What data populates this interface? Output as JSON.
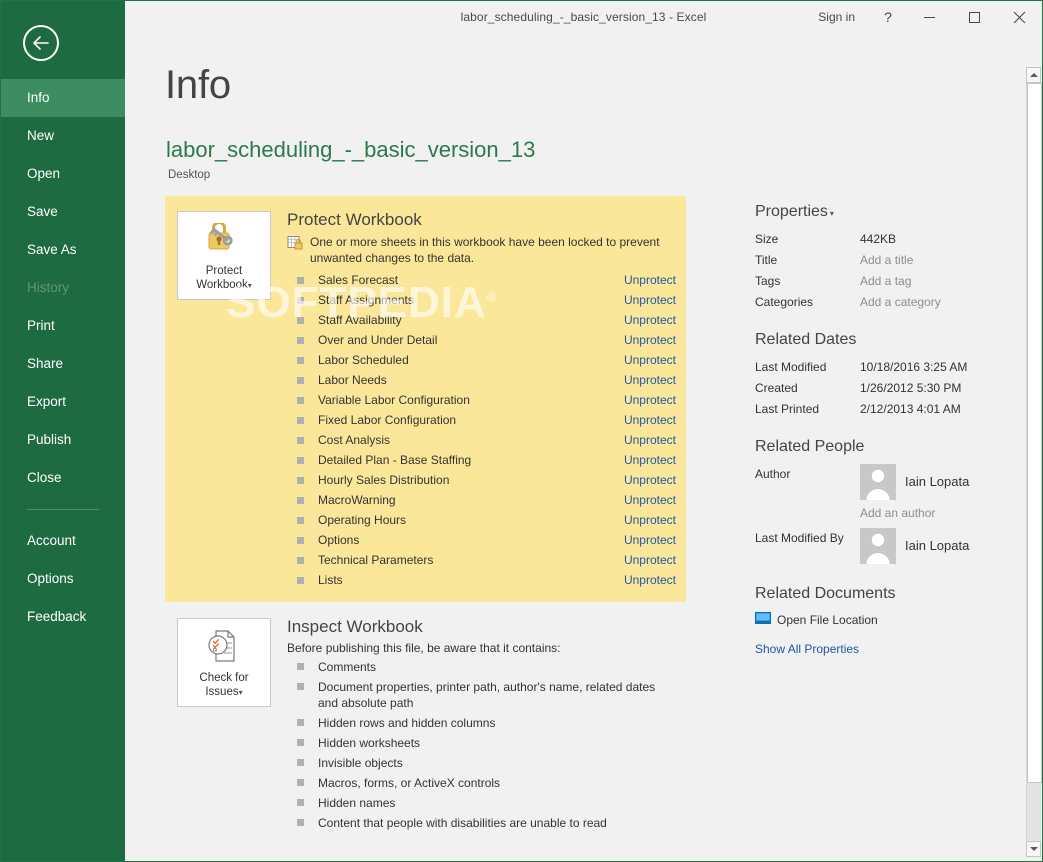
{
  "window": {
    "title": "labor_scheduling_-_basic_version_13 - Excel",
    "sign_in": "Sign in",
    "help_glyph": "?",
    "minimize_name": "minimize",
    "maximize_name": "maximize",
    "close_name": "close"
  },
  "sidebar": {
    "back_label": "Back",
    "items": [
      {
        "label": "Info",
        "state": "active"
      },
      {
        "label": "New",
        "state": "normal"
      },
      {
        "label": "Open",
        "state": "normal"
      },
      {
        "label": "Save",
        "state": "normal"
      },
      {
        "label": "Save As",
        "state": "normal"
      },
      {
        "label": "History",
        "state": "disabled"
      },
      {
        "label": "Print",
        "state": "normal"
      },
      {
        "label": "Share",
        "state": "normal"
      },
      {
        "label": "Export",
        "state": "normal"
      },
      {
        "label": "Publish",
        "state": "normal"
      },
      {
        "label": "Close",
        "state": "normal"
      }
    ],
    "items_bottom": [
      {
        "label": "Account",
        "state": "normal"
      },
      {
        "label": "Options",
        "state": "normal"
      },
      {
        "label": "Feedback",
        "state": "normal"
      }
    ]
  },
  "page": {
    "heading": "Info",
    "file_name": "labor_scheduling_-_basic_version_13",
    "file_path": "Desktop",
    "watermark": "SOFTPEDIA",
    "watermark_mark": "®"
  },
  "protect": {
    "button_line1": "Protect",
    "button_line2": "Workbook",
    "caret": "▾",
    "title": "Protect Workbook",
    "description": "One or more sheets in this workbook have been locked to prevent unwanted changes to the data.",
    "action_label": "Unprotect",
    "sheets": [
      "Sales Forecast",
      "Staff Assignments",
      "Staff Availability",
      "Over and Under Detail",
      "Labor Scheduled",
      "Labor Needs",
      "Variable Labor Configuration",
      "Fixed Labor Configuration",
      "Cost Analysis",
      "Detailed Plan - Base Staffing",
      "Hourly Sales Distribution",
      "MacroWarning",
      "Operating Hours",
      "Options",
      "Technical Parameters",
      "Lists"
    ]
  },
  "inspect": {
    "button_line1": "Check for",
    "button_line2": "Issues",
    "caret": "▾",
    "title": "Inspect Workbook",
    "subtitle": "Before publishing this file, be aware that it contains:",
    "items": [
      "Comments",
      "Document properties, printer path, author's name, related dates and absolute path",
      "Hidden rows and hidden columns",
      "Hidden worksheets",
      "Invisible objects",
      "Macros, forms, or ActiveX controls",
      "Hidden names",
      "Content that people with disabilities are unable to read"
    ]
  },
  "properties": {
    "heading": "Properties",
    "caret": "▾",
    "rows": [
      {
        "label": "Size",
        "value": "442KB",
        "placeholder": false
      },
      {
        "label": "Title",
        "value": "Add a title",
        "placeholder": true
      },
      {
        "label": "Tags",
        "value": "Add a tag",
        "placeholder": true
      },
      {
        "label": "Categories",
        "value": "Add a category",
        "placeholder": true
      }
    ]
  },
  "related_dates": {
    "heading": "Related Dates",
    "rows": [
      {
        "label": "Last Modified",
        "value": "10/18/2016 3:25 AM"
      },
      {
        "label": "Created",
        "value": "1/26/2012 5:30 PM"
      },
      {
        "label": "Last Printed",
        "value": "2/12/2013 4:01 AM"
      }
    ]
  },
  "related_people": {
    "heading": "Related People",
    "author_label": "Author",
    "author_name": "Iain Lopata",
    "add_author": "Add an author",
    "modified_by_label": "Last Modified By",
    "modified_by_name": "Iain Lopata"
  },
  "related_documents": {
    "heading": "Related Documents",
    "open_file_location": "Open File Location",
    "show_all_properties": "Show All Properties"
  },
  "colors": {
    "rail_green": "#1e6b41",
    "rail_active": "#3e8c62",
    "accent_link": "#2156a5",
    "warning_bg": "#fbe79a",
    "file_name_green": "#2b7a4b"
  }
}
